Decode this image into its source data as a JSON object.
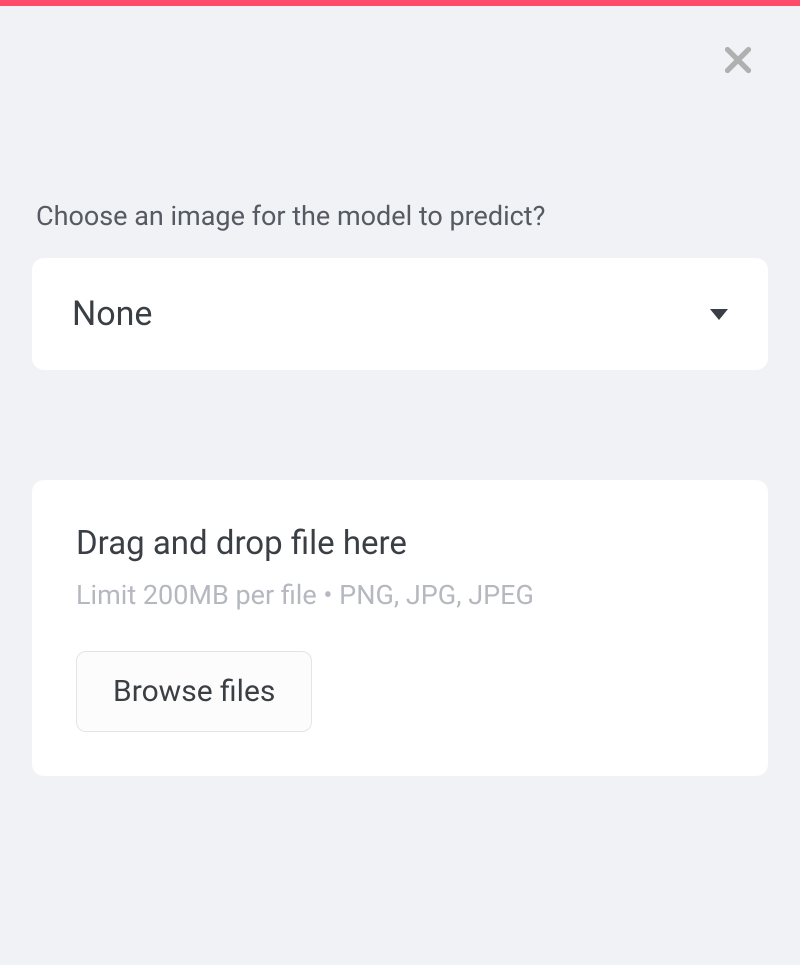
{
  "accent_color": "#ff4b6a",
  "prompt_label": "Choose an image for the model to predict?",
  "select": {
    "value": "None"
  },
  "uploader": {
    "title": "Drag and drop file here",
    "hint": "Limit 200MB per file • PNG, JPG, JPEG",
    "browse_label": "Browse files"
  },
  "icons": {
    "close": "close-icon",
    "caret": "caret-down-icon"
  }
}
